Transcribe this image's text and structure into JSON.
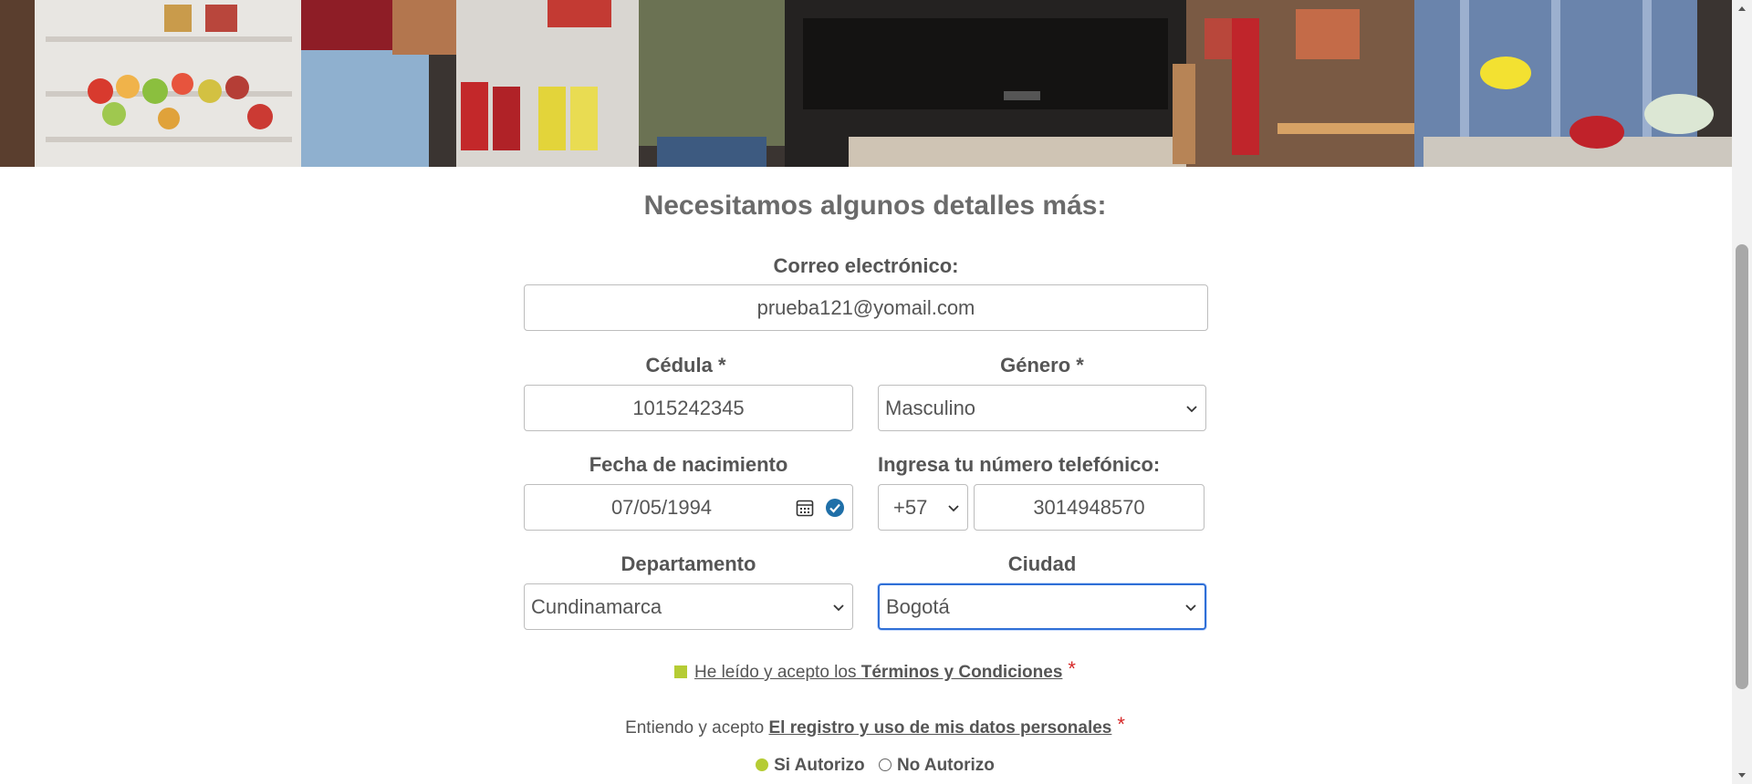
{
  "form": {
    "title": "Necesitamos algunos detalles más:",
    "email": {
      "label": "Correo electrónico:",
      "value": "prueba121@yomail.com"
    },
    "cedula": {
      "label": "Cédula *",
      "value": "1015242345"
    },
    "genero": {
      "label": "Género *",
      "value": "Masculino"
    },
    "fecha": {
      "label": "Fecha de nacimiento",
      "value": "07/05/1994"
    },
    "telefono": {
      "label": "Ingresa tu número telefónico:",
      "code": "+57",
      "value": "3014948570"
    },
    "departamento": {
      "label": "Departamento",
      "value": "Cundinamarca"
    },
    "ciudad": {
      "label": "Ciudad",
      "value": "Bogotá"
    },
    "terms": {
      "prefix": "He leído y acepto los",
      "link": "Términos y Condiciones",
      "required": "*"
    },
    "data_consent": {
      "prefix": "Entiendo y acepto",
      "link": "El registro y uso de mis datos personales",
      "required": "*"
    },
    "authorize": {
      "yes": "Si Autorizo",
      "no": "No Autorizo",
      "selected": "yes"
    }
  },
  "colors": {
    "accent": "#b5cc34",
    "required": "#d62828",
    "focus": "#2f6fd6",
    "text": "#555555"
  }
}
